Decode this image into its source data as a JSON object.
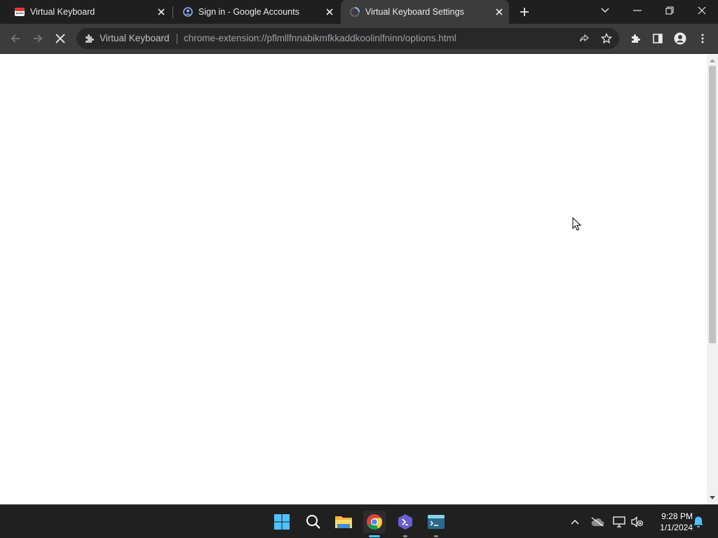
{
  "tabs": [
    {
      "title": "Virtual Keyboard",
      "active": false,
      "favicon": "virtual-keyboard-favicon"
    },
    {
      "title": "Sign in - Google Accounts",
      "active": false,
      "favicon": "google-accounts-favicon"
    },
    {
      "title": "Virtual Keyboard Settings",
      "active": true,
      "favicon": "loading-spinner-icon"
    }
  ],
  "toolbar": {
    "site_chip": "Virtual Keyboard",
    "url": "chrome-extension://pflmllfnnabikmfkkaddkoolinlfninn/options.html"
  },
  "taskbar": {
    "apps": [
      "start-button",
      "search",
      "file-explorer",
      "chrome",
      "visual-studio",
      "terminal-app"
    ],
    "time": "9:28 PM",
    "date": "1/1/2024"
  },
  "colors": {
    "titlebar": "#1f1f1f",
    "toolbar": "#3c3c3c",
    "omnibox": "#282828",
    "taskbar": "#202020",
    "accent": "#4cc2ff"
  }
}
